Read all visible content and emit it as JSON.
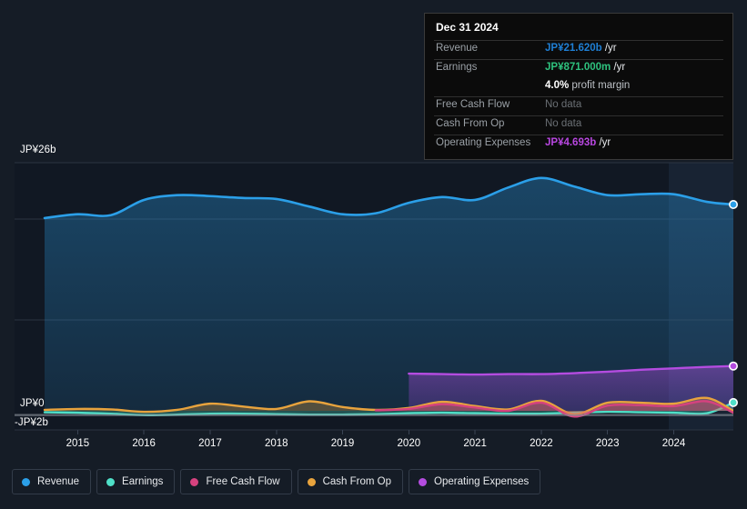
{
  "theme": {
    "background": "#151c26",
    "plot_background": "#111823",
    "gridline": "#2b3442",
    "zero_line": "#8a9099",
    "axis_text": "#ffffff"
  },
  "tooltip": {
    "date": "Dec 31 2024",
    "rows": [
      {
        "label": "Revenue",
        "value": "JP¥21.620b",
        "unit": "/yr",
        "color": "#1f7fd4",
        "nodata": false
      },
      {
        "label": "Earnings",
        "value": "JP¥871.000m",
        "unit": "/yr",
        "color": "#2ec27e",
        "nodata": false
      },
      {
        "label": "",
        "value": "4.0%",
        "unit": "profit margin",
        "color": "#ffffff",
        "nodata": false
      },
      {
        "label": "Free Cash Flow",
        "value": "No data",
        "unit": "",
        "color": "#6b7075",
        "nodata": true
      },
      {
        "label": "Cash From Op",
        "value": "No data",
        "unit": "",
        "color": "#6b7075",
        "nodata": true
      },
      {
        "label": "Operating Expenses",
        "value": "JP¥4.693b",
        "unit": "/yr",
        "color": "#b847e0",
        "nodata": false
      }
    ]
  },
  "legend": {
    "items": [
      {
        "label": "Revenue",
        "color": "#2b9fe8"
      },
      {
        "label": "Earnings",
        "color": "#4fe0c8"
      },
      {
        "label": "Free Cash Flow",
        "color": "#d6427f"
      },
      {
        "label": "Cash From Op",
        "color": "#e8a martin"
      },
      {
        "label": "Operating Expenses",
        "color": "#b44ce0"
      }
    ]
  },
  "axes": {
    "y_labels": [
      {
        "text": "JP¥26b"
      },
      {
        "text": "JP¥0"
      },
      {
        "text": "-JP¥2b"
      }
    ],
    "x_labels": [
      "2015",
      "2016",
      "2017",
      "2018",
      "2019",
      "2020",
      "2021",
      "2022",
      "2023",
      "2024"
    ]
  },
  "chart_data": {
    "type": "line",
    "title": "",
    "xlabel": "",
    "ylabel": "JP¥",
    "ylim": [
      -2,
      26
    ],
    "y_ticks": [
      26,
      0,
      -2
    ],
    "y_tick_labels": [
      "JP¥26b",
      "JP¥0",
      "-JP¥2b"
    ],
    "grid": true,
    "legend_position": "bottom-left",
    "currency": "JP¥",
    "unit": "billions",
    "x_tick_labels": [
      "2015",
      "2016",
      "2017",
      "2018",
      "2019",
      "2020",
      "2021",
      "2022",
      "2023",
      "2024"
    ],
    "x": [
      2014.5,
      2015.0,
      2015.5,
      2016.0,
      2016.5,
      2017.0,
      2017.5,
      2018.0,
      2018.5,
      2019.0,
      2019.5,
      2020.0,
      2020.5,
      2021.0,
      2021.5,
      2022.0,
      2022.5,
      2023.0,
      2023.5,
      2024.0,
      2024.5,
      2024.9
    ],
    "forecast_start": 2023.8,
    "series": [
      {
        "name": "Revenue",
        "color": "#2b9fe8",
        "filled": true,
        "values": [
          20.2,
          20.6,
          20.5,
          22.1,
          22.6,
          22.5,
          22.3,
          22.2,
          21.4,
          20.6,
          20.7,
          21.8,
          22.4,
          22.1,
          23.4,
          24.4,
          23.5,
          22.6,
          22.7,
          22.7,
          21.9,
          21.62
        ]
      },
      {
        "name": "Earnings",
        "color": "#4fe0c8",
        "filled": true,
        "values": [
          -0.15,
          -0.2,
          -0.3,
          -0.45,
          -0.4,
          -0.3,
          -0.3,
          -0.35,
          -0.4,
          -0.4,
          -0.35,
          -0.25,
          -0.2,
          -0.25,
          -0.3,
          -0.3,
          -0.2,
          -0.1,
          -0.15,
          -0.2,
          -0.25,
          0.871
        ]
      },
      {
        "name": "Free Cash Flow",
        "color": "#d6427f",
        "filled": true,
        "values": [
          null,
          null,
          null,
          null,
          null,
          null,
          null,
          null,
          null,
          null,
          0.05,
          0.2,
          0.7,
          0.35,
          0.0,
          0.85,
          -0.6,
          0.55,
          0.6,
          0.5,
          1.0,
          -0.2
        ]
      },
      {
        "name": "Cash From Op",
        "color": "#e8a33d",
        "filled": true,
        "values": [
          0.1,
          0.2,
          0.15,
          -0.1,
          0.1,
          0.75,
          0.45,
          0.2,
          1.0,
          0.4,
          0.1,
          0.3,
          0.95,
          0.5,
          0.15,
          1.05,
          -0.35,
          0.85,
          0.85,
          0.75,
          1.35,
          0.0
        ]
      },
      {
        "name": "Operating Expenses",
        "color": "#b44ce0",
        "filled": true,
        "values": [
          null,
          null,
          null,
          null,
          null,
          null,
          null,
          null,
          null,
          null,
          null,
          3.9,
          3.85,
          3.8,
          3.85,
          3.85,
          3.95,
          4.1,
          4.3,
          4.45,
          4.6,
          4.693
        ]
      }
    ],
    "endpoint_markers": [
      {
        "series": "Revenue",
        "value": 21.62,
        "color": "#2b9fe8"
      },
      {
        "series": "Operating Expenses",
        "value": 4.693,
        "color": "#b44ce0"
      },
      {
        "series": "Earnings",
        "value": 0.871,
        "color": "#4fe0c8"
      }
    ]
  }
}
